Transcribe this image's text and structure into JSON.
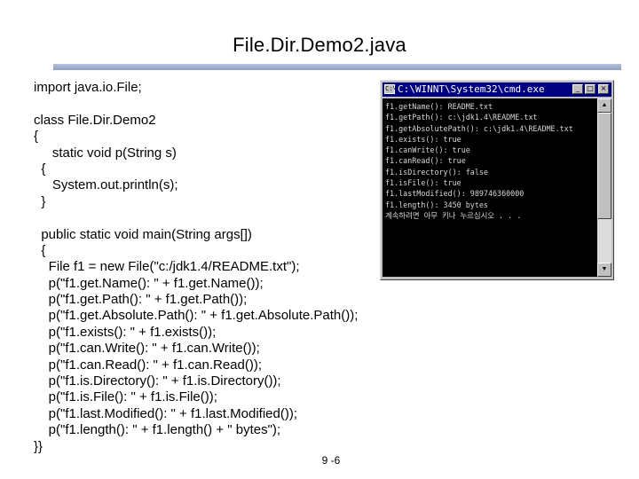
{
  "slide": {
    "title": "File.Dir.Demo2.java",
    "page_number": "9 -6"
  },
  "code_lines": [
    "import java.io.File;",
    "",
    "class File.Dir.Demo2",
    "{",
    "     static void p(String s)",
    "  {",
    "     System.out.println(s);",
    "  }",
    "",
    "  public static void main(String args[])",
    "  {",
    "    File f1 = new File(\"c:/jdk1.4/README.txt\");",
    "    p(\"f1.get.Name(): \" + f1.get.Name());",
    "    p(\"f1.get.Path(): \" + f1.get.Path());",
    "    p(\"f1.get.Absolute.Path(): \" + f1.get.Absolute.Path());",
    "    p(\"f1.exists(): \" + f1.exists());",
    "    p(\"f1.can.Write(): \" + f1.can.Write());",
    "    p(\"f1.can.Read(): \" + f1.can.Read());",
    "    p(\"f1.is.Directory(): \" + f1.is.Directory());",
    "    p(\"f1.is.File(): \" + f1.is.File());",
    "    p(\"f1.last.Modified(): \" + f1.last.Modified());",
    "    p(\"f1.length(): \" + f1.length() + \" bytes\");",
    "}}"
  ],
  "console": {
    "title": "C:\\WINNT\\System32\\cmd.exe",
    "icon_label": "C:\\",
    "minimize_glyph": "_",
    "maximize_glyph": "□",
    "close_glyph": "×",
    "scroll_up_glyph": "▲",
    "scroll_down_glyph": "▼",
    "lines": [
      "f1.getName(): README.txt",
      "f1.getPath(): c:\\jdk1.4\\README.txt",
      "f1.getAbsolutePath(): c:\\jdk1.4\\README.txt",
      "f1.exists(): true",
      "f1.canWrite(): true",
      "f1.canRead(): true",
      "f1.isDirectory(): false",
      "f1.isFile(): true",
      "f1.lastModified(): 989746360000",
      "f1.length(): 3450 bytes",
      "계속하려면 아무 키나 누르십시오 . . ."
    ],
    "text_color": "#d8d8d8",
    "titlebar_color": "#000080"
  },
  "colors": {
    "title_rule": "#8f9cc1",
    "background": "#ffffff"
  }
}
